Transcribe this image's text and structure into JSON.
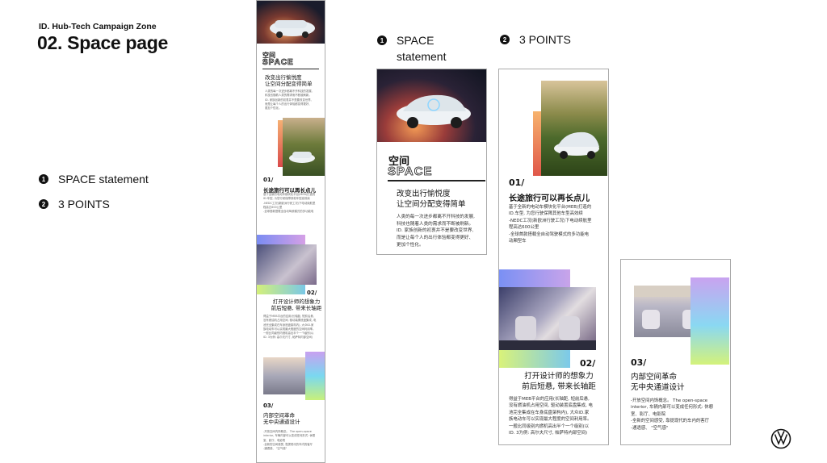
{
  "header": {
    "kicker": "ID. Hub-Tech Campaign Zone",
    "title": "02. Space page"
  },
  "left_list": [
    {
      "num": "1",
      "label": "SPACE statement"
    },
    {
      "num": "2",
      "label": "3 POINTS"
    }
  ],
  "top_labels": {
    "a_num": "1",
    "a_label_1": "SPACE",
    "a_label_2": "statement",
    "b_num": "2",
    "b_label": "3 POINTS"
  },
  "space_card": {
    "title_cn": "空间",
    "title_en": "SPACE",
    "headline_1": "改变出行愉悦度",
    "headline_2": "让空间分配变得简单",
    "body": [
      "人类的每一次进步都离不开科技的发展,",
      "科技也随着人类的需求而不断被刷新。",
      "ID. 家族创新的初衷并不是要改变世界,",
      "而是让每个人的出行体验都变得更好、",
      "更加个性化。"
    ]
  },
  "point1": {
    "num": "01/",
    "title": "长途旅行可以再长点儿",
    "body": [
      "基于全新的电动车模块化平台(MEB)打造的",
      "ID.车型, 为您行驶保障其他车型高效续",
      "-NEDC工况(新欧洲行驶工况)下电动续航里",
      "程高达600公里",
      "-全球首款搭载全自动驾驶模式的多功能电",
      "动厢型车"
    ]
  },
  "point2": {
    "num": "02/",
    "title_1": "打开设计师的想象力",
    "title_2": "前后短悬, 带来长轴距",
    "body": [
      "得益于MEB平台的应用(长轴距, 短前后悬,",
      "没有燃油机占用空间, 驱动装置底盘集成, 电",
      "池完全集成在车身底盘架构内), 大众ID.家",
      "族电动车可以实现最大程度的空间利用率。",
      "一般比同级别内燃机高出半个一个级别(以",
      "ID. 3为例: 高尔夫尺寸, 帕萨特内部空间)"
    ]
  },
  "point3": {
    "num": "03/",
    "title_1": "内部空间革命",
    "title_2": "无中央通道设计",
    "body": [
      "-开放空间内饰概念。 The open-space",
      "interior, 车辆内部可以变成任何形式: 休憩",
      "室、影厅、电影院",
      "-全新的空间感受, 靠提现代的车内的客厅",
      "-通透感、 \"空气感\""
    ]
  },
  "colors": {
    "accent_blue": "#5b8def",
    "accent_green": "#b6e34a",
    "accent_orange": "#ef6a3c"
  },
  "icons": {
    "brand": "vw-logo-icon"
  }
}
